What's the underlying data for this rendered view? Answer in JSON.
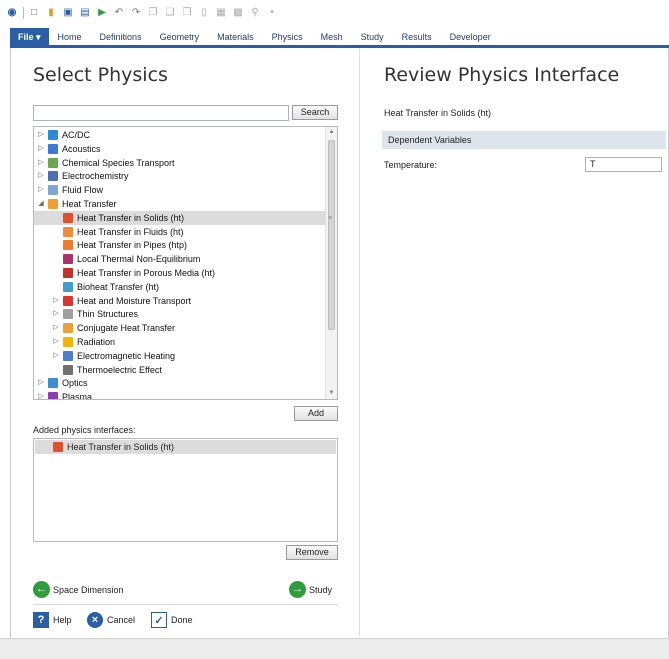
{
  "ribbon": {
    "tabs": [
      "File ▾",
      "Home",
      "Definitions",
      "Geometry",
      "Materials",
      "Physics",
      "Mesh",
      "Study",
      "Results",
      "Developer"
    ]
  },
  "left": {
    "title": "Select Physics",
    "search": {
      "value": "",
      "button": "Search"
    },
    "tree": [
      {
        "label": "AC/DC",
        "level": 0,
        "expander": "▷",
        "icon": "acdc-icon",
        "color": "#2a8bd6"
      },
      {
        "label": "Acoustics",
        "level": 0,
        "expander": "▷",
        "icon": "acoustics-icon",
        "color": "#3a7bd5"
      },
      {
        "label": "Chemical Species Transport",
        "level": 0,
        "expander": "▷",
        "icon": "chemical-species-icon",
        "color": "#6aa84f"
      },
      {
        "label": "Electrochemistry",
        "level": 0,
        "expander": "▷",
        "icon": "electrochemistry-icon",
        "color": "#4a6fb5"
      },
      {
        "label": "Fluid Flow",
        "level": 0,
        "expander": "▷",
        "icon": "fluid-flow-icon",
        "color": "#7fa7d6"
      },
      {
        "label": "Heat Transfer",
        "level": 0,
        "expander": "◢",
        "icon": "heat-transfer-icon",
        "color": "#f0a030"
      },
      {
        "label": "Heat Transfer in Solids (ht)",
        "level": 1,
        "expander": "",
        "icon": "heat-solids-icon",
        "color": "#e2502b",
        "selected": true
      },
      {
        "label": "Heat Transfer in Fluids (ht)",
        "level": 1,
        "expander": "",
        "icon": "heat-fluids-icon",
        "color": "#f28a3a"
      },
      {
        "label": "Heat Transfer in Pipes (htp)",
        "level": 1,
        "expander": "",
        "icon": "heat-pipes-icon",
        "color": "#f07a2a"
      },
      {
        "label": "Local Thermal Non-Equilibrium",
        "level": 1,
        "expander": "",
        "icon": "thermal-nonequilibrium-icon",
        "color": "#b0306a"
      },
      {
        "label": "Heat Transfer in Porous Media (ht)",
        "level": 1,
        "expander": "",
        "icon": "heat-porous-icon",
        "color": "#c8302b"
      },
      {
        "label": "Bioheat Transfer (ht)",
        "level": 1,
        "expander": "",
        "icon": "bioheat-icon",
        "color": "#3fa0d0"
      },
      {
        "label": "Heat and Moisture Transport",
        "level": 1,
        "expander": "▷",
        "icon": "heat-moisture-icon",
        "color": "#d9352b"
      },
      {
        "label": "Thin Structures",
        "level": 1,
        "expander": "▷",
        "icon": "thin-structures-icon",
        "color": "#a0a0a0"
      },
      {
        "label": "Conjugate Heat Transfer",
        "level": 1,
        "expander": "▷",
        "icon": "conjugate-heat-icon",
        "color": "#f0a030"
      },
      {
        "label": "Radiation",
        "level": 1,
        "expander": "▷",
        "icon": "radiation-icon",
        "color": "#f4b400"
      },
      {
        "label": "Electromagnetic Heating",
        "level": 1,
        "expander": "▷",
        "icon": "em-heating-icon",
        "color": "#4a7fd0"
      },
      {
        "label": "Thermoelectric Effect",
        "level": 1,
        "expander": "",
        "icon": "thermoelectric-icon",
        "color": "#707070"
      },
      {
        "label": "Optics",
        "level": 0,
        "expander": "▷",
        "icon": "optics-icon",
        "color": "#3a8fd0"
      },
      {
        "label": "Plasma",
        "level": 0,
        "expander": "▷",
        "icon": "plasma-icon",
        "color": "#8a3fb0"
      }
    ],
    "add_button": "Add",
    "added_label": "Added physics interfaces:",
    "added_items": [
      "Heat Transfer in Solids (ht)"
    ],
    "remove_button": "Remove",
    "space_dimension": "Space Dimension",
    "study": "Study",
    "help": "Help",
    "cancel": "Cancel",
    "done": "Done"
  },
  "right": {
    "title": "Review Physics Interface",
    "interface_name": "Heat Transfer in Solids (ht)",
    "section": "Dependent Variables",
    "field_label": "Temperature:",
    "field_value": "T"
  }
}
